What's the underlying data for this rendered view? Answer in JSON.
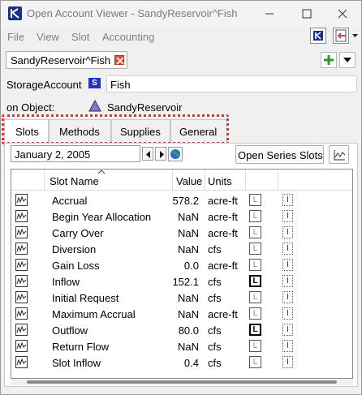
{
  "window": {
    "title": "Open Account Viewer - SandyReservoir^Fish",
    "icons": {
      "app": "riverware-app-icon",
      "minimize": "minimize-icon",
      "maximize": "maximize-icon",
      "close": "close-icon"
    }
  },
  "menubar": {
    "items": [
      "File",
      "View",
      "Slot",
      "Accounting"
    ]
  },
  "account_tab": {
    "label": "SandyReservoir^Fish"
  },
  "storage_account": {
    "label": "StorageAccount",
    "type_badge": "S",
    "name": "Fish"
  },
  "on_object": {
    "label": "on Object:",
    "name": "SandyReservoir"
  },
  "tabs": [
    {
      "label": "Slots",
      "active": true
    },
    {
      "label": "Methods",
      "active": false
    },
    {
      "label": "Supplies",
      "active": false
    },
    {
      "label": "General",
      "active": false
    }
  ],
  "toolbar": {
    "date": "January 2, 2005",
    "open_series_label": "Open Series Slots"
  },
  "table": {
    "headers": {
      "name": "Slot Name",
      "value": "Value",
      "units": "Units"
    },
    "rows": [
      {
        "name": "Accrual",
        "value": "578.2",
        "units": "acre-ft",
        "l_bold": false
      },
      {
        "name": "Begin Year Allocation",
        "value": "NaN",
        "units": "acre-ft",
        "l_bold": false
      },
      {
        "name": "Carry Over",
        "value": "NaN",
        "units": "acre-ft",
        "l_bold": false
      },
      {
        "name": "Diversion",
        "value": "NaN",
        "units": "cfs",
        "l_bold": false
      },
      {
        "name": "Gain Loss",
        "value": "0.0",
        "units": "acre-ft",
        "l_bold": false
      },
      {
        "name": "Inflow",
        "value": "152.1",
        "units": "cfs",
        "l_bold": true
      },
      {
        "name": "Initial Request",
        "value": "NaN",
        "units": "cfs",
        "l_bold": false
      },
      {
        "name": "Maximum Accrual",
        "value": "NaN",
        "units": "acre-ft",
        "l_bold": false
      },
      {
        "name": "Outflow",
        "value": "80.0",
        "units": "cfs",
        "l_bold": true
      },
      {
        "name": "Return Flow",
        "value": "NaN",
        "units": "cfs",
        "l_bold": false
      },
      {
        "name": "Slot Inflow",
        "value": "0.4",
        "units": "cfs",
        "l_bold": false
      }
    ]
  },
  "colors": {
    "highlight_box": "#e0332a",
    "type_badge": "#1a36c7"
  }
}
